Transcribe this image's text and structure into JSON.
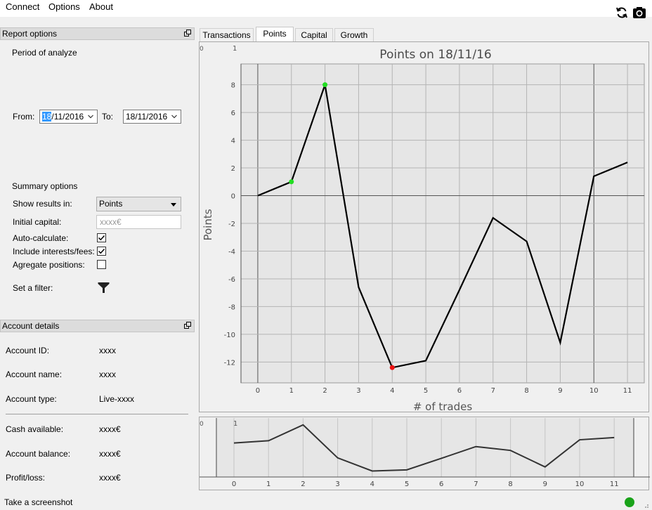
{
  "menu": {
    "items": [
      "Connect",
      "Options",
      "About"
    ]
  },
  "toolbar": {
    "refresh_icon": "refresh-icon",
    "screenshot_icon": "camera-icon"
  },
  "report_options": {
    "title": "Report options",
    "period_label": "Period of analyze",
    "from_label": "From:",
    "from_selected": "18",
    "from_rest": "/11/2016",
    "to_label": "To:",
    "to_value": "18/11/2016",
    "summary_label": "Summary options",
    "show_results_label": "Show results in:",
    "show_results_value": "Points",
    "initial_capital_label": "Initial capital:",
    "initial_capital_placeholder": "xxxx€",
    "auto_calc_label": "Auto-calculate:",
    "auto_calc_checked": true,
    "include_fees_label": "Include interests/fees:",
    "include_fees_checked": true,
    "aggregate_label": "Agregate positions:",
    "aggregate_checked": false,
    "filter_label": "Set a filter:"
  },
  "account_details": {
    "title": "Account details",
    "rows_top": [
      {
        "label": "Account ID:",
        "value": "xxxx"
      },
      {
        "label": "Account name:",
        "value": "xxxx"
      },
      {
        "label": "Account type:",
        "value": "Live-xxxx"
      }
    ],
    "rows_bottom": [
      {
        "label": "Cash available:",
        "value": "xxxx€"
      },
      {
        "label": "Account balance:",
        "value": "xxxx€"
      },
      {
        "label": "Profit/loss:",
        "value": "xxxx€"
      }
    ]
  },
  "tabs": [
    "Transactions",
    "Points",
    "Capital",
    "Growth"
  ],
  "active_tab": "Points",
  "status": {
    "screenshot_label": "Take a screenshot",
    "indicator_color": "#1aa31a"
  },
  "chart_data": {
    "type": "line",
    "title": "Points on 18/11/16",
    "xlabel": "# of trades",
    "ylabel": "Points",
    "x": [
      0,
      1,
      2,
      3,
      4,
      5,
      6,
      7,
      8,
      9,
      10,
      11
    ],
    "y": [
      0,
      1,
      8,
      -6.6,
      -12.4,
      -11.9,
      -6.8,
      -1.6,
      -3.3,
      -10.6,
      1.4,
      2.4
    ],
    "xlim": [
      -0.5,
      11.5
    ],
    "ylim": [
      -13.5,
      9.5
    ],
    "yticks": [
      8,
      6,
      4,
      2,
      0,
      -2,
      -4,
      -6,
      -8,
      -10,
      -12
    ],
    "xticks": [
      0,
      1,
      2,
      3,
      4,
      5,
      6,
      7,
      8,
      9,
      10,
      11
    ],
    "corner_labels": [
      "0",
      "1"
    ],
    "grid": true,
    "highlight_points": [
      {
        "x": 1,
        "y": 1,
        "color": "#22dd22"
      },
      {
        "x": 2,
        "y": 8,
        "color": "#22dd22"
      },
      {
        "x": 4,
        "y": -12.4,
        "color": "#ee1111"
      }
    ],
    "line_color": "#000000",
    "overview": {
      "xticks": [
        0,
        1,
        2,
        3,
        4,
        5,
        6,
        7,
        8,
        9,
        10,
        11
      ],
      "corner_labels": [
        "0",
        "1"
      ]
    }
  }
}
